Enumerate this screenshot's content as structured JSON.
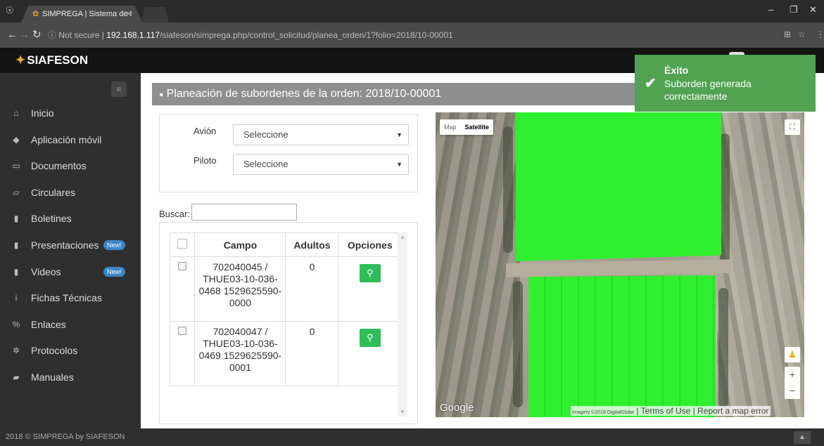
{
  "browser": {
    "tab_title": "SIMPREGA | Sistema de I",
    "tab_close": "×",
    "url_prefix": "Not secure",
    "url_separator": "|",
    "url_host": "192.168.1.117",
    "url_path": "/siafeson/simprega.php/control_solicitud/planea_orden/1?folio=2018/10-00001"
  },
  "app": {
    "brand": "SIAFESON"
  },
  "sidebar": {
    "items": [
      {
        "label": "Inicio",
        "icon": "home-icon",
        "glyph": "⌂"
      },
      {
        "label": "Aplicación móvil",
        "icon": "mobile-app-icon",
        "glyph": "◆"
      },
      {
        "label": "Documentos",
        "icon": "folder-icon",
        "glyph": "▭"
      },
      {
        "label": "Circulares",
        "icon": "folder-open-icon",
        "glyph": "▱"
      },
      {
        "label": "Boletines",
        "icon": "file-icon",
        "glyph": "▮"
      },
      {
        "label": "Presentaciones",
        "icon": "file-icon",
        "glyph": "▮",
        "badge": "New!"
      },
      {
        "label": "Videos",
        "icon": "file-icon",
        "glyph": "▮",
        "badge": "New!"
      },
      {
        "label": "Fichas Técnicas",
        "icon": "info-icon",
        "glyph": "i"
      },
      {
        "label": "Enlaces",
        "icon": "link-icon",
        "glyph": "%"
      },
      {
        "label": "Protocolos",
        "icon": "gear-icon",
        "glyph": "✲"
      },
      {
        "label": "Manuales",
        "icon": "book-icon",
        "glyph": "▰"
      }
    ]
  },
  "main": {
    "title": "Planeación de subordenes de la orden: 2018/10-00001",
    "form": {
      "avion_label": "Avión",
      "avion_value": "Seleccione",
      "piloto_label": "Piloto",
      "piloto_value": "Seleccione"
    },
    "search_label": "Buscar:",
    "search_value": "",
    "table": {
      "headers": [
        "Campo",
        "Adultos",
        "Opciones"
      ],
      "rows": [
        {
          "campo": "702040045 / THUE03-10-036-0468 1529625590-0000",
          "adultos": "0"
        },
        {
          "campo": "702040047 / THUE03-10-036-0469 1529625590-0001",
          "adultos": "0"
        }
      ]
    }
  },
  "map": {
    "type_map": "Map",
    "type_satellite": "Satellite",
    "logo": "Google",
    "imagery": "Imagery ©2018 DigitalGlobe",
    "terms": "Terms of Use",
    "report": "Report a map error",
    "field_color": "#2ef02e"
  },
  "toast": {
    "title": "Éxito",
    "message": "Suborden generada correctamente",
    "color": "#51a351"
  },
  "footer": {
    "text": "2018 © SIMPREGA by SIAFESON"
  }
}
